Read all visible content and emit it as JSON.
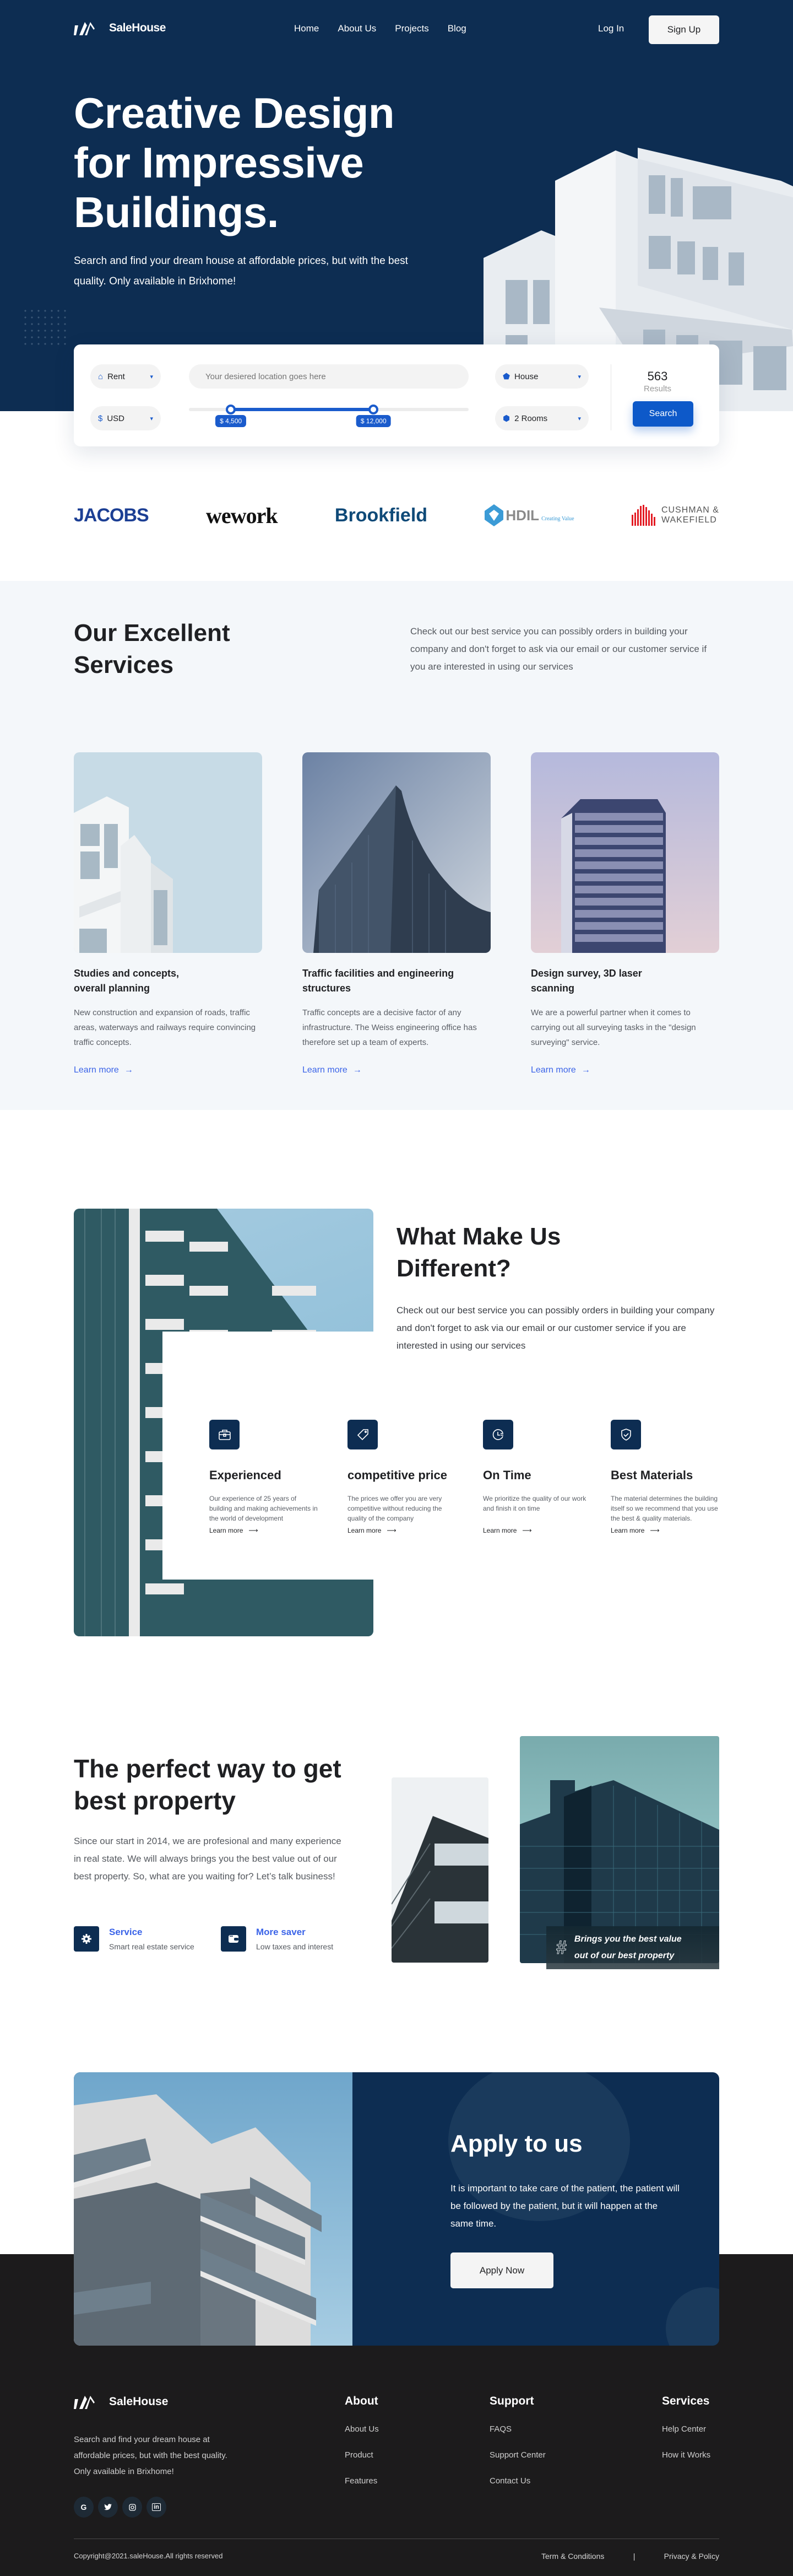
{
  "brand": {
    "name": "SaleHouse"
  },
  "nav": {
    "links": [
      "Home",
      "About Us",
      "Projects",
      "Blog"
    ],
    "login": "Log In",
    "signup": "Sign Up"
  },
  "hero": {
    "title_lines": [
      "Creative Design",
      "for Impressive",
      "Buildings."
    ],
    "subtitle": "Search and find your dream house at affordable prices, but with the best quality. Only available in Brixhome!"
  },
  "search": {
    "mode": "Rent",
    "location_placeholder": "Your desiered location goes here",
    "currency": "USD",
    "property_type": "House",
    "rooms": "2 Rooms",
    "price_min_label": "$ 4,500",
    "price_max_label": "$ 12,000",
    "price_min_fraction": 0.15,
    "price_max_fraction": 0.66,
    "results_count": "563",
    "results_label": "Results",
    "button": "Search"
  },
  "partners": [
    "JACOBS",
    "wework",
    "Brookfield",
    "HDIL",
    "Creating Value",
    "CUSHMAN &",
    "WAKEFIELD"
  ],
  "services": {
    "title_lines": [
      "Our Excellent",
      "Services"
    ],
    "intro": "Check out our best service you can possibly orders in building your company and don't forget to ask via our email or our customer service if you are interested in using our services",
    "cards": [
      {
        "title_lines": [
          "Studies and concepts,",
          "overall planning"
        ],
        "desc": "New construction and expansion of roads, traffic areas, waterways and railways require convincing traffic concepts.",
        "link": "Learn more"
      },
      {
        "title_lines": [
          "Traffic facilities and engineering",
          "structures"
        ],
        "desc": "Traffic concepts are a decisive factor of any infrastructure. The Weiss engineering office has therefore set up a team of experts.",
        "link": "Learn more"
      },
      {
        "title_lines": [
          "Design survey, 3D laser",
          "scanning"
        ],
        "desc": "We are a powerful partner when it comes to carrying out all surveying tasks in the \"design surveying\" service.",
        "link": "Learn more"
      }
    ]
  },
  "different": {
    "title_lines": [
      "What Make Us",
      "Different?"
    ],
    "intro": "Check out our best service you can possibly orders in building your company and don't forget to ask via our email or our customer service if you are interested in using our services",
    "features": [
      {
        "icon": "briefcase-icon",
        "title": "Experienced",
        "desc": "Our experience of 25 years of building and making achievements in the world of development",
        "link": "Learn more"
      },
      {
        "icon": "tag-icon",
        "title": "competitive price",
        "desc": "The prices we offer you are very competitive without reducing the quality of the company",
        "link": "Learn more"
      },
      {
        "icon": "clock-icon",
        "title": "On Time",
        "desc": "We prioritize the quality of our work and finish it on time",
        "link": "Learn more"
      },
      {
        "icon": "shield-check-icon",
        "title": "Best Materials",
        "desc": "The material determines the building itself so we recommend that you use the best & quality materials.",
        "link": "Learn more"
      }
    ]
  },
  "perfect": {
    "title_lines": [
      "The perfect way to get",
      "best property"
    ],
    "desc": "Since our start in 2014, we are profesional and many experience in real state. We will always brings you the best value out of our best property. So, what are you waiting for? Let’s talk business!",
    "items": [
      {
        "icon": "gear-icon",
        "title": "Service",
        "sub": "Smart real estate service"
      },
      {
        "icon": "wallet-icon",
        "title": "More saver",
        "sub": "Low taxes and interest"
      }
    ],
    "badge_lines": [
      "Brings you the best value",
      "out of our best property"
    ]
  },
  "apply": {
    "title": "Apply to us",
    "desc": "It is important to take care of the patient, the patient will be followed by the patient, but it will happen at the same time.",
    "button": "Apply Now"
  },
  "footer": {
    "desc": "Search and find your dream house at affordable prices, but with the best quality. Only available in Brixhome!",
    "social": [
      "G",
      "twitter",
      "instagram",
      "in"
    ],
    "columns": [
      {
        "title": "About",
        "links": [
          "About Us",
          "Product",
          "Features"
        ]
      },
      {
        "title": "Support",
        "links": [
          "FAQS",
          "Support Center",
          "Contact Us"
        ]
      },
      {
        "title": "Services",
        "links": [
          "Help Center",
          "How it Works"
        ]
      }
    ],
    "copyright": "Copyright@2021.saleHouse.All rights reserved",
    "terms": "Term & Conditions",
    "separator": "|",
    "privacy": "Privacy & Policy"
  },
  "colors": {
    "primary": "#0d2d52",
    "accent": "#0d59c9",
    "link": "#3a63e8",
    "footer_bg": "#1c1b1c",
    "services_bg": "#f4f7fa"
  }
}
